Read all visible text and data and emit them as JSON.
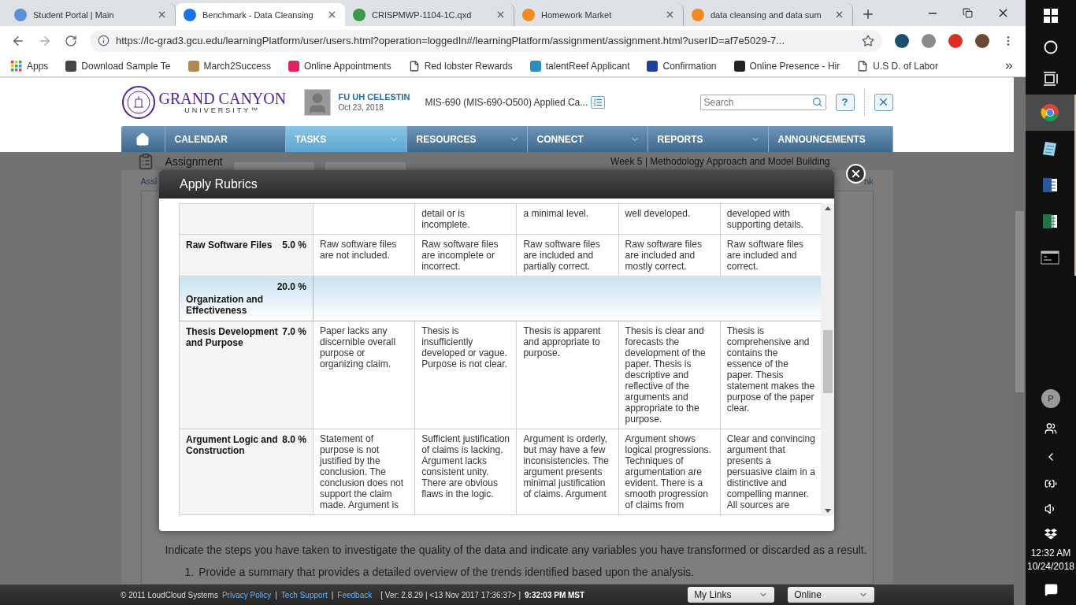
{
  "browser": {
    "tabs": [
      {
        "title": "Student Portal | Main",
        "selected": false,
        "color": "#5b8fd6"
      },
      {
        "title": "Benchmark - Data Cleansing",
        "selected": true,
        "color": "#1a73e8"
      },
      {
        "title": "CRISPMWP-1104-1C.qxd",
        "selected": false,
        "color": "#3a9a4a"
      },
      {
        "title": "Homework Market",
        "selected": false,
        "color": "#f08a24"
      },
      {
        "title": "data cleansing and data sum",
        "selected": false,
        "color": "#f08a24"
      }
    ],
    "url": "https://lc-grad3.gcu.edu/learningPlatform/user/users.html?operation=loggedIn#/learningPlatform/assignment/assignment.html?userID=af7e5029-7...",
    "bookmarks": [
      {
        "label": "Apps",
        "kind": "apps"
      },
      {
        "label": "Download Sample Te",
        "kind": "logo",
        "color": "#444444"
      },
      {
        "label": "March2Success",
        "kind": "logo",
        "color": "#b08850"
      },
      {
        "label": "Online Appointments",
        "kind": "logo",
        "color": "#e0245e"
      },
      {
        "label": "Red lobster Rewards",
        "kind": "doc"
      },
      {
        "label": "talentReef Applicant",
        "kind": "logo",
        "color": "#2a8fb8"
      },
      {
        "label": "Confirmation",
        "kind": "logo",
        "color": "#1d3fa0"
      },
      {
        "label": "Online Presence - Hir",
        "kind": "logo",
        "color": "#222222"
      },
      {
        "label": "U.S D. of Labor",
        "kind": "doc"
      }
    ]
  },
  "header": {
    "logo_line1": "GRAND CANYON",
    "logo_line2": "UNIVERSITY™",
    "user_name": "FU UH CELESTIN",
    "date": "Oct 23, 2018",
    "course": "MIS-690 (MIS-690-O500) Applied Ca...",
    "search_placeholder": "Search",
    "help": "?"
  },
  "nav": [
    {
      "label": "CALENDAR",
      "selected": false,
      "dropdown": false
    },
    {
      "label": "TASKS",
      "selected": true,
      "dropdown": true
    },
    {
      "label": "RESOURCES",
      "selected": false,
      "dropdown": true
    },
    {
      "label": "CONNECT",
      "selected": false,
      "dropdown": true
    },
    {
      "label": "REPORTS",
      "selected": false,
      "dropdown": true
    },
    {
      "label": "ANNOUNCEMENTS",
      "selected": false,
      "dropdown": false
    }
  ],
  "background": {
    "title": "Assignment",
    "week": "Week 5 | Methodology Approach and Model Building",
    "left_fragment": "Assi",
    "right_fragment": "nk",
    "instructions": "Indicate the steps you have taken to investigate the quality of the data and indicate any variables you have transformed or discarded as a result.",
    "steps": [
      {
        "number": "1.",
        "text": "Provide a summary that provides a detailed overview of the trends identified based upon the analysis."
      }
    ]
  },
  "modal": {
    "title": "Apply Rubrics",
    "rows": [
      {
        "kind": "criterion",
        "cells": [
          {},
          {
            "text": "detail or is incomplete."
          },
          {
            "text": "a minimal level."
          },
          {
            "text": "well developed."
          },
          {
            "text": "developed with supporting details."
          }
        ]
      },
      {
        "kind": "criterion",
        "name": "Raw Software Files",
        "weight": "5.0 %",
        "cells": [
          {
            "text": "Raw software files are not included."
          },
          {
            "text": "Raw software files are incomplete or incorrect."
          },
          {
            "text": "Raw software files are included and partially correct."
          },
          {
            "text": "Raw software files are included and mostly correct."
          },
          {
            "text": "Raw software files are included and correct."
          }
        ]
      },
      {
        "kind": "section",
        "name": "Organization and Effectiveness",
        "weight": "20.0 %"
      },
      {
        "kind": "criterion",
        "name": "Thesis Development and Purpose",
        "weight": "7.0 %",
        "cells": [
          {
            "text": "Paper lacks any discernible overall purpose or organizing claim."
          },
          {
            "text": "Thesis is insufficiently developed or vague. Purpose is not clear."
          },
          {
            "text": "Thesis is apparent and appropriate to purpose."
          },
          {
            "text": "Thesis is clear and forecasts the development of the paper. Thesis is descriptive and reflective of the arguments and appropriate to the purpose."
          },
          {
            "text": "Thesis is comprehensive and contains the essence of the paper. Thesis statement makes the purpose of the paper clear."
          }
        ]
      },
      {
        "kind": "criterion",
        "name": "Argument Logic and Construction",
        "weight": "8.0 %",
        "cells": [
          {
            "text": "Statement of purpose is not justified by the conclusion. The conclusion does not support the claim made. Argument is"
          },
          {
            "text": "Sufficient justification of claims is lacking. Argument lacks consistent unity. There are obvious flaws in the logic."
          },
          {
            "text": "Argument is orderly, but may have a few inconsistencies. The argument presents minimal justification of claims. Argument"
          },
          {
            "text": "Argument shows logical progressions. Techniques of argumentation are evident. There is a smooth progression of claims from"
          },
          {
            "text": "Clear and convincing argument that presents a persuasive claim in a distinctive and compelling manner. All sources are"
          }
        ]
      }
    ]
  },
  "footer": {
    "copyright": "© 2011 LoudCloud Systems",
    "items": [
      {
        "kind": "link",
        "text": "Privacy Policy"
      },
      {
        "kind": "sep",
        "text": "|"
      },
      {
        "kind": "link",
        "text": "Tech Support"
      },
      {
        "kind": "sep",
        "text": "|"
      },
      {
        "kind": "link",
        "text": "Feedback"
      }
    ],
    "version": "[ Ver: 2.8.29 | <13 Nov 2017 17:36:37> ]",
    "time": "9:32:03 PM MST",
    "dropdowns": [
      "My Links",
      "Online"
    ]
  },
  "taskbar": {
    "apps": [
      {
        "kind": "chrome",
        "selected": true
      },
      {
        "kind": "notepad",
        "selected": false
      },
      {
        "kind": "word",
        "selected": false
      },
      {
        "kind": "excel",
        "selected": false
      },
      {
        "kind": "console",
        "selected": false
      }
    ],
    "avatar": "P",
    "time": "12:32 AM",
    "date": "10/24/2018"
  }
}
